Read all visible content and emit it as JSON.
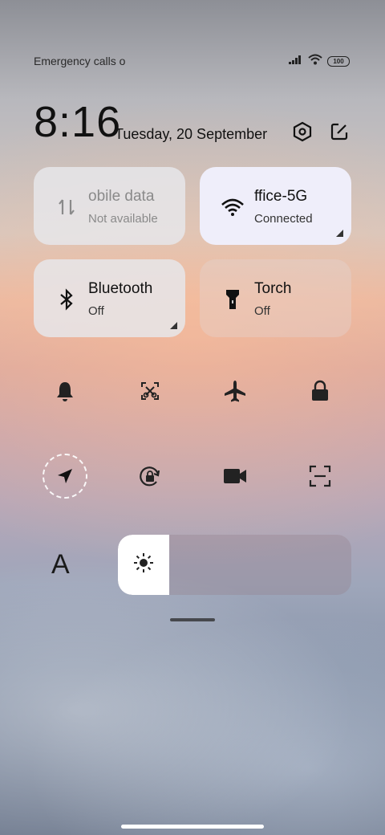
{
  "status_bar": {
    "carrier_text": "Emergency calls o",
    "battery_level": "100",
    "signal_icon": "cell-signal-icon",
    "wifi_icon": "wifi-icon"
  },
  "header": {
    "time": "8:16",
    "date": "Tuesday, 20 September",
    "settings_icon": "settings-hexagon-icon",
    "edit_icon": "edit-icon"
  },
  "tiles": [
    {
      "title": "obile data",
      "subtitle": "Not available",
      "icon": "mobile-data-icon",
      "state": "disabled"
    },
    {
      "title": "ffice-5G",
      "subtitle": "Connected",
      "icon": "wifi-icon",
      "state": "active"
    },
    {
      "title": "Bluetooth",
      "subtitle": "Off",
      "icon": "bluetooth-icon",
      "state": "inactive"
    },
    {
      "title": "Torch",
      "subtitle": "Off",
      "icon": "flashlight-icon",
      "state": "inactive"
    }
  ],
  "quick_toggles_row1": [
    "bell-icon",
    "screenshot-crop-icon",
    "airplane-icon",
    "lock-icon"
  ],
  "quick_toggles_row2": [
    "location-arrow-icon",
    "rotation-lock-icon",
    "video-camera-icon",
    "scan-icon"
  ],
  "brightness": {
    "level_fraction": 0.22,
    "icon": "sun-icon"
  },
  "font_label": "A",
  "colors": {
    "active_tile": "#f0f0fc",
    "inactive_tile": "#e6e6ea",
    "accent": "#ffffff"
  }
}
